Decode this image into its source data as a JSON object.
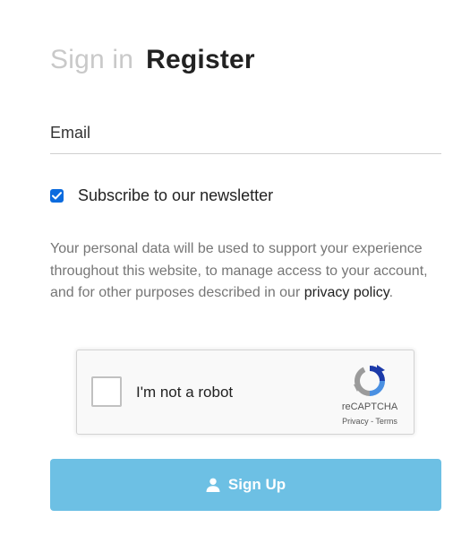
{
  "tabs": {
    "sign_in": "Sign in",
    "register": "Register"
  },
  "email": {
    "placeholder": "Email",
    "value": ""
  },
  "newsletter": {
    "label": "Subscribe to our newsletter",
    "checked": true
  },
  "privacy": {
    "text": "Your personal data will be used to support your experience throughout this website, to manage access to your account, and for other purposes described in our ",
    "link_text": "privacy policy",
    "suffix": "."
  },
  "captcha": {
    "label": "I'm not a robot",
    "brand": "reCAPTCHA",
    "privacy": "Privacy",
    "separator": " - ",
    "terms": "Terms",
    "logo_icon": "recaptcha-logo-icon"
  },
  "signup": {
    "label": "Sign Up",
    "icon": "user-icon"
  },
  "colors": {
    "inactive_tab": "#c9c9c9",
    "active_tab": "#222222",
    "checkbox": "#0b6bde",
    "button_bg": "#6dc0e4",
    "button_text": "#ffffff",
    "muted_text": "#767676"
  }
}
